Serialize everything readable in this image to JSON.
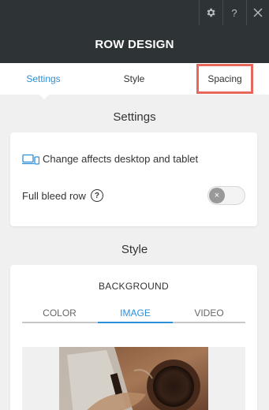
{
  "window": {
    "help_label": "?",
    "title": "ROW DESIGN"
  },
  "tabs": {
    "settings": "Settings",
    "style": "Style",
    "spacing": "Spacing"
  },
  "settings_section": {
    "title": "Settings",
    "device_note": "Change affects desktop and tablet",
    "full_bleed_label": "Full bleed row",
    "full_bleed_help": "?",
    "full_bleed_enabled": false
  },
  "style_section": {
    "title": "Style",
    "background_label": "BACKGROUND",
    "background_tabs": [
      "COLOR",
      "IMAGE",
      "VIDEO"
    ],
    "active_background_tab": "IMAGE"
  },
  "colors": {
    "header_bg": "#2e3336",
    "accent": "#2d8fd5",
    "highlight_box": "#e8665c"
  },
  "icons": {
    "gear": "gear-icon",
    "help": "help-icon",
    "close": "close-icon",
    "devices": "devices-icon",
    "question": "question-circle-icon",
    "toggle_off": "toggle-off-icon"
  }
}
